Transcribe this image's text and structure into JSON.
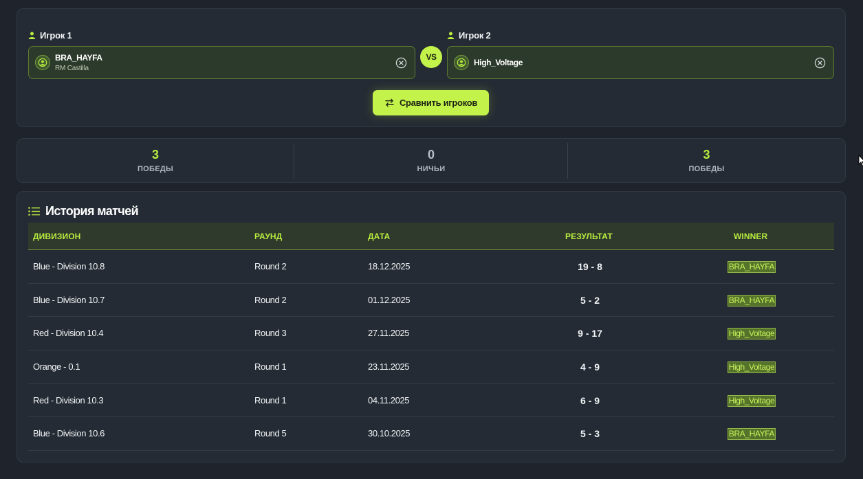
{
  "players": {
    "player1": {
      "label": "Игрок 1",
      "name": "BRA_HAYFA",
      "team": "RM Castilla"
    },
    "player2": {
      "label": "Игрок 2",
      "name": "High_Voltage",
      "team": ""
    },
    "vs_label": "VS",
    "compare_label": "Сравнить игроков"
  },
  "stats": {
    "wins1": {
      "value": "3",
      "label": "ПОБЕДЫ"
    },
    "draws": {
      "value": "0",
      "label": "НИЧЬИ"
    },
    "wins2": {
      "value": "3",
      "label": "ПОБЕДЫ"
    }
  },
  "history": {
    "title": "История матчей",
    "columns": [
      "ДИВИЗИОН",
      "РАУНД",
      "ДАТА",
      "РЕЗУЛЬТАТ",
      "WINNER"
    ],
    "rows": [
      {
        "division": "Blue - Division 10.8",
        "round": "Round 2",
        "date": "18.12.2025",
        "result": "19 - 8",
        "winner": "BRA_HAYFA"
      },
      {
        "division": "Blue - Division 10.7",
        "round": "Round 2",
        "date": "01.12.2025",
        "result": "5 - 2",
        "winner": "BRA_HAYFA"
      },
      {
        "division": "Red - Division 10.4",
        "round": "Round 3",
        "date": "27.11.2025",
        "result": "9 - 17",
        "winner": "High_Voltage"
      },
      {
        "division": "Orange - 0.1",
        "round": "Round 1",
        "date": "23.11.2025",
        "result": "4 - 9",
        "winner": "High_Voltage"
      },
      {
        "division": "Red - Division 10.3",
        "round": "Round 1",
        "date": "04.11.2025",
        "result": "6 - 9",
        "winner": "High_Voltage"
      },
      {
        "division": "Blue - Division 10.6",
        "round": "Round 5",
        "date": "30.10.2025",
        "result": "5 - 3",
        "winner": "BRA_HAYFA"
      }
    ]
  },
  "colors": {
    "accent": "#c3f24a",
    "background": "#1f242c",
    "card": "#252b34"
  },
  "icons": {
    "player": "user-icon",
    "clear": "close-circle-icon",
    "avatar": "avatar-icon",
    "compare": "swap-arrows-icon",
    "history": "list-icon"
  }
}
